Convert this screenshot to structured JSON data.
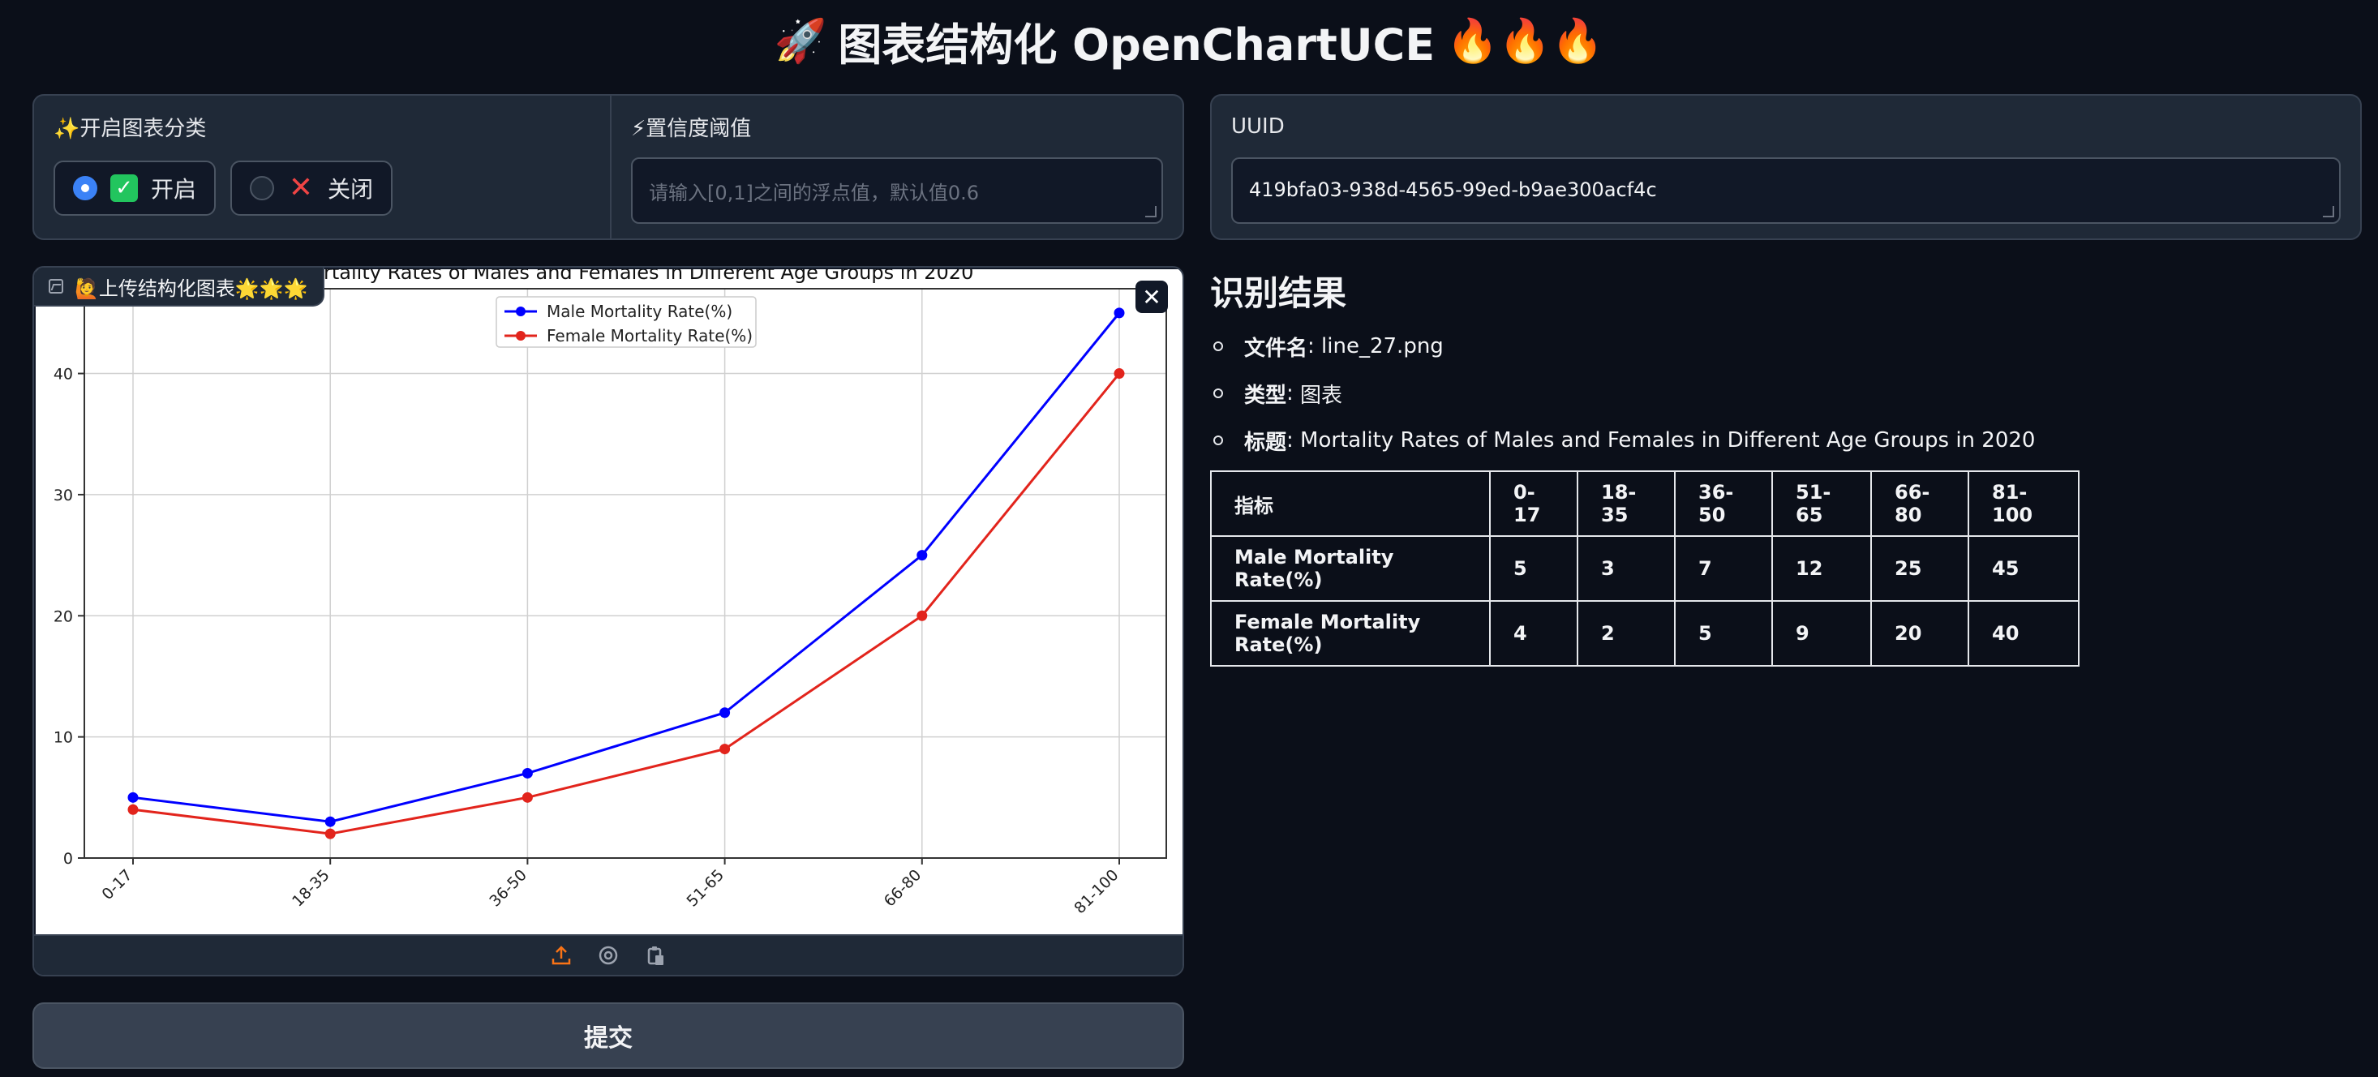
{
  "app": {
    "title_emoji_left": "🚀",
    "title": "图表结构化 OpenChartUCE",
    "title_emoji_right": "🔥🔥🔥"
  },
  "options": {
    "classify_label": "✨开启图表分类",
    "radio_on": "开启",
    "radio_off": "关闭",
    "threshold_label": "⚡置信度阈值",
    "threshold_placeholder": "请输入[0,1]之间的浮点值，默认值0.6"
  },
  "uuid": {
    "label": "UUID",
    "value": "419bfa03-938d-4565-99ed-b9ae300acf4c"
  },
  "image_panel": {
    "label": "🙋上传结构化图表🌟🌟🌟",
    "close": "✕",
    "icons": [
      "upload-icon",
      "camera-icon",
      "paste-icon"
    ]
  },
  "submit_label": "提交",
  "results": {
    "heading": "识别结果",
    "filename_key": "文件名",
    "filename_value": "line_27.png",
    "type_key": "类型",
    "type_value": "图表",
    "title_key": "标题",
    "title_value": "Mortality Rates of Males and Females in Different Age Groups in 2020",
    "table": {
      "headers": [
        "指标",
        "0-17",
        "18-35",
        "36-50",
        "51-65",
        "66-80",
        "81-100"
      ],
      "rows": [
        [
          "Male Mortality Rate(%)",
          "5",
          "3",
          "7",
          "12",
          "25",
          "45"
        ],
        [
          "Female Mortality Rate(%)",
          "4",
          "2",
          "5",
          "9",
          "20",
          "40"
        ]
      ]
    }
  },
  "chart_data": {
    "type": "line",
    "title": "Mortality Rates of Males and Females in Different Age Groups in 2020",
    "categories": [
      "0-17",
      "18-35",
      "36-50",
      "51-65",
      "66-80",
      "81-100"
    ],
    "series": [
      {
        "name": "Male Mortality Rate(%)",
        "values": [
          5,
          3,
          7,
          12,
          25,
          45
        ],
        "color": "#0000ff"
      },
      {
        "name": "Female Mortality Rate(%)",
        "values": [
          4,
          2,
          5,
          9,
          20,
          40
        ],
        "color": "#e2241c"
      }
    ],
    "ylim": [
      0,
      47
    ],
    "yticks": [
      0,
      10,
      20,
      30,
      40
    ],
    "grid": true,
    "legend": "top-center"
  },
  "colors": {
    "background": "#0b0f19",
    "panel": "#1f2937",
    "accent": "#3b82f6",
    "upload_icon": "#f97316"
  }
}
